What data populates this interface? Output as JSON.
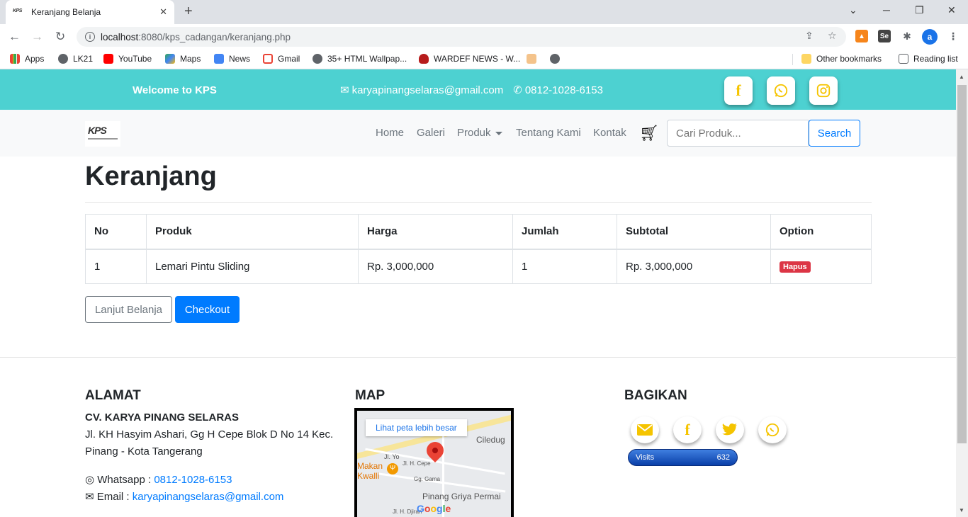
{
  "browser": {
    "tab_title": "Keranjang Belanja",
    "tab_favicon": "KPS",
    "url_host": "localhost",
    "url_rest": ":8080/kps_cadangan/keranjang.php",
    "profile_initial": "a",
    "bookmarks": [
      "Apps",
      "LK21",
      "YouTube",
      "Maps",
      "News",
      "Gmail",
      "35+ HTML Wallpap...",
      "WARDEF NEWS - W..."
    ],
    "other_bookmarks": "Other bookmarks",
    "reading_list": "Reading list"
  },
  "topbar": {
    "welcome": "Welcome to KPS",
    "email": "karyapinangselaras@gmail.com",
    "phone": "0812-1028-6153",
    "color": "#4dd1d1"
  },
  "navbar": {
    "logo_text": "KPS",
    "links": [
      "Home",
      "Galeri",
      "Produk",
      "Tentang Kami",
      "Kontak"
    ],
    "search_placeholder": "Cari Produk...",
    "search_button": "Search"
  },
  "page": {
    "title": "Keranjang",
    "table": {
      "headers": [
        "No",
        "Produk",
        "Harga",
        "Jumlah",
        "Subtotal",
        "Option"
      ],
      "rows": [
        {
          "no": "1",
          "produk": "Lemari Pintu Sliding",
          "harga": "Rp. 3,000,000",
          "jumlah": "1",
          "subtotal": "Rp. 3,000,000",
          "option": "Hapus"
        }
      ]
    },
    "continue_button": "Lanjut Belanja",
    "checkout_button": "Checkout"
  },
  "footer": {
    "alamat_title": "ALAMAT",
    "company": "CV. KARYA PINANG SELARAS",
    "address": "Jl. KH Hasyim Ashari, Gg H Cepe Blok D No 14 Kec. Pinang - Kota Tangerang",
    "whatsapp_label": "Whatsapp : ",
    "whatsapp": "0812-1028-6153",
    "email_label": "Email : ",
    "email": "karyapinangselaras@gmail.com",
    "map_title": "MAP",
    "map_link": "Lihat peta lebih besar",
    "map_labels": [
      "Ciledug",
      "Makan",
      "Kwalli",
      "Pinang Griya Permai",
      "Jl. H. Cepe",
      "Jl. Yo",
      "Gg. Gama",
      "Jl. H. Djiran",
      "Google"
    ],
    "bagikan_title": "BAGIKAN",
    "visits_label": "Visits",
    "visits_count": "632"
  }
}
